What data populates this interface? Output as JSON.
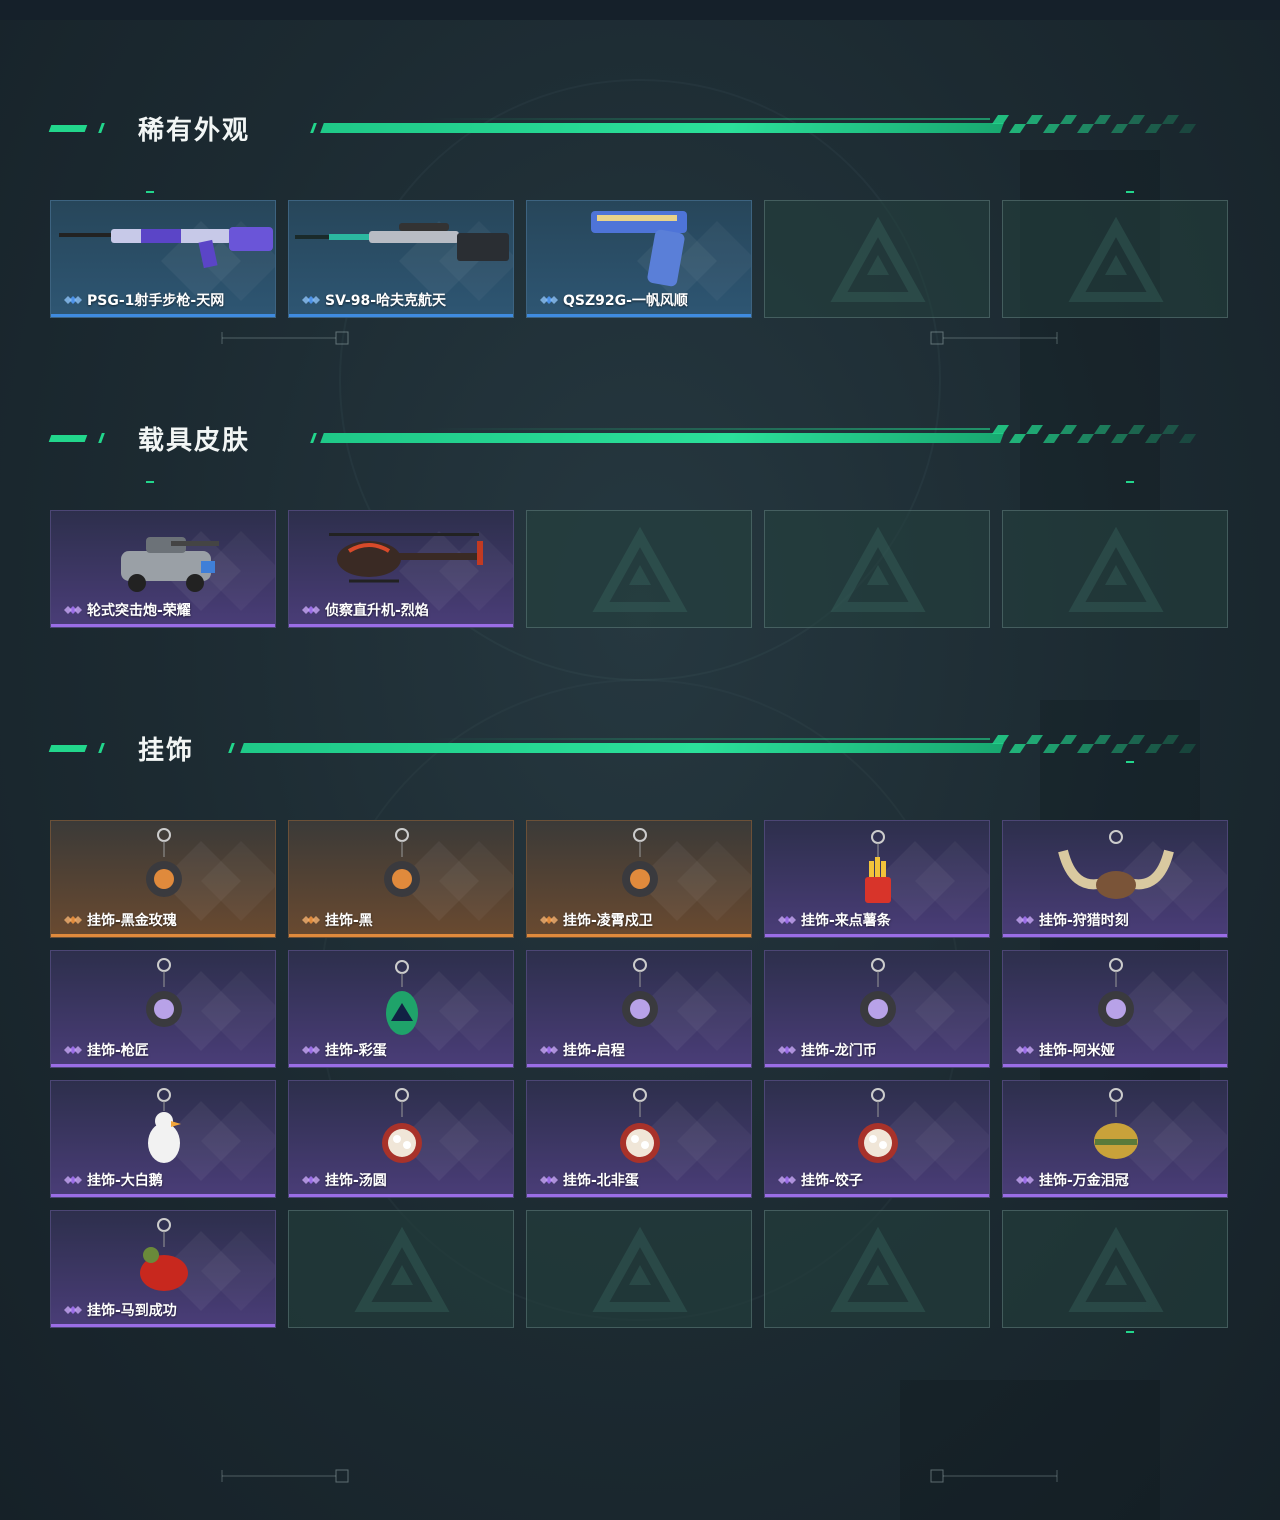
{
  "colors": {
    "accent": "#22d68c",
    "rarity_blue": "#3f8be0",
    "rarity_purple": "#9a6de6",
    "rarity_orange": "#e08a3c"
  },
  "sections": [
    {
      "title": "稀有外观",
      "items": [
        {
          "name": "PSG-1射手步枪-天网",
          "rarity": "blue",
          "icon": "rifle-icon"
        },
        {
          "name": "SV-98-哈夫克航天",
          "rarity": "blue",
          "icon": "sniper-rifle-icon"
        },
        {
          "name": "QSZ92G-一帆风顺",
          "rarity": "blue",
          "icon": "pistol-icon"
        },
        {
          "name": "",
          "rarity": "empty"
        },
        {
          "name": "",
          "rarity": "empty"
        }
      ]
    },
    {
      "title": "载具皮肤",
      "items": [
        {
          "name": "轮式突击炮-荣耀",
          "rarity": "purple",
          "icon": "armored-vehicle-icon"
        },
        {
          "name": "侦察直升机-烈焰",
          "rarity": "purple",
          "icon": "helicopter-icon"
        },
        {
          "name": "",
          "rarity": "empty"
        },
        {
          "name": "",
          "rarity": "empty"
        },
        {
          "name": "",
          "rarity": "empty"
        }
      ]
    },
    {
      "title": "挂饰",
      "items": [
        {
          "name": "挂饰-黑金玫瑰",
          "rarity": "orange",
          "icon": "charm-icon"
        },
        {
          "name": "挂饰-黑",
          "rarity": "orange",
          "icon": "charm-icon"
        },
        {
          "name": "挂饰-凌霄戍卫",
          "rarity": "orange",
          "icon": "charm-icon"
        },
        {
          "name": "挂饰-来点薯条",
          "rarity": "purple",
          "icon": "fries-charm-icon"
        },
        {
          "name": "挂饰-狩猎时刻",
          "rarity": "purple",
          "icon": "antler-charm-icon"
        },
        {
          "name": "挂饰-枪匠",
          "rarity": "purple",
          "icon": "charm-icon"
        },
        {
          "name": "挂饰-彩蛋",
          "rarity": "purple",
          "icon": "egg-charm-icon"
        },
        {
          "name": "挂饰-启程",
          "rarity": "purple",
          "icon": "charm-icon"
        },
        {
          "name": "挂饰-龙门币",
          "rarity": "purple",
          "icon": "charm-icon"
        },
        {
          "name": "挂饰-阿米娅",
          "rarity": "purple",
          "icon": "charm-icon"
        },
        {
          "name": "挂饰-大白鹅",
          "rarity": "purple",
          "icon": "goose-charm-icon"
        },
        {
          "name": "挂饰-汤圆",
          "rarity": "purple",
          "icon": "bowl-charm-icon"
        },
        {
          "name": "挂饰-北非蛋",
          "rarity": "purple",
          "icon": "bowl-charm-icon"
        },
        {
          "name": "挂饰-饺子",
          "rarity": "purple",
          "icon": "bowl-charm-icon"
        },
        {
          "name": "挂饰-万金泪冠",
          "rarity": "purple",
          "icon": "crown-charm-icon"
        },
        {
          "name": "挂饰-马到成功",
          "rarity": "purple",
          "icon": "horse-charm-icon"
        },
        {
          "name": "",
          "rarity": "empty"
        },
        {
          "name": "",
          "rarity": "empty"
        },
        {
          "name": "",
          "rarity": "empty"
        },
        {
          "name": "",
          "rarity": "empty"
        }
      ]
    }
  ]
}
